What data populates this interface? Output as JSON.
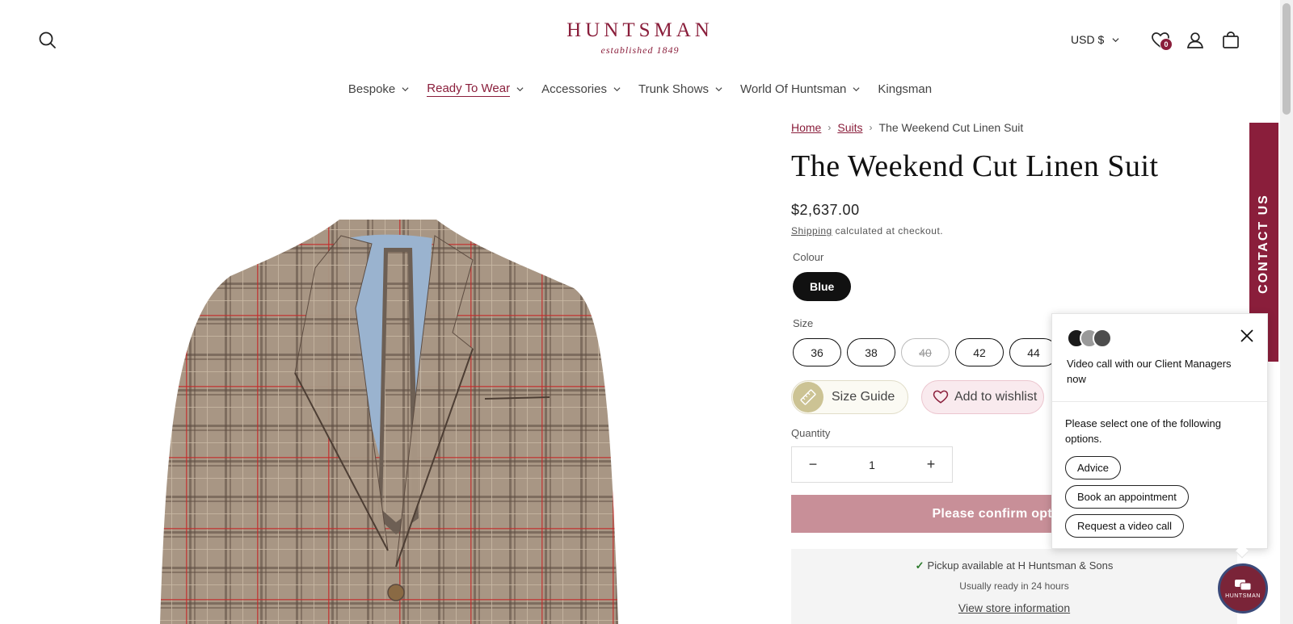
{
  "header": {
    "logo_word": "HUNTSMAN",
    "logo_sub": "established 1849",
    "currency": "USD $",
    "wishlist_count": "0"
  },
  "nav": {
    "items": [
      {
        "label": "Bespoke",
        "has_dropdown": true,
        "active": false
      },
      {
        "label": "Ready To Wear",
        "has_dropdown": true,
        "active": true
      },
      {
        "label": "Accessories",
        "has_dropdown": true,
        "active": false
      },
      {
        "label": "Trunk Shows",
        "has_dropdown": true,
        "active": false
      },
      {
        "label": "World Of Huntsman",
        "has_dropdown": true,
        "active": false
      },
      {
        "label": "Kingsman",
        "has_dropdown": false,
        "active": false
      }
    ]
  },
  "breadcrumb": {
    "home": "Home",
    "suits": "Suits",
    "current": "The Weekend Cut Linen Suit"
  },
  "product": {
    "title": "The Weekend Cut Linen Suit",
    "price": "$2,637.00",
    "shipping_link": "Shipping",
    "shipping_text": " calculated at checkout.",
    "colour_label": "Colour",
    "colour_selected": "Blue",
    "size_label": "Size",
    "sizes": [
      {
        "label": "36",
        "available": true
      },
      {
        "label": "38",
        "available": true
      },
      {
        "label": "40",
        "available": false
      },
      {
        "label": "42",
        "available": true
      },
      {
        "label": "44",
        "available": true
      }
    ],
    "size_guide_label": "Size Guide",
    "wishlist_label": "Add to wishlist",
    "quantity_label": "Quantity",
    "quantity_value": "1",
    "quantity_minus": "−",
    "quantity_plus": "+",
    "confirm_label": "Please confirm options to"
  },
  "pickup": {
    "check": "✓",
    "line1_prefix": "Pickup available at ",
    "line1_store": "H Huntsman & Sons",
    "line2": "Usually ready in 24 hours",
    "line3": "View store information"
  },
  "contact_tab": "CONTACT US",
  "chat": {
    "heading": "Video call with our Client Managers now",
    "prompt": "Please select one of the following options.",
    "options": [
      "Advice",
      "Book an appointment",
      "Request a video call"
    ],
    "launcher_brand": "HUNTSMAN"
  },
  "colors": {
    "brand": "#8a1e3b",
    "confirm_button": "#c88f98",
    "wishlist_bg": "#f9eaee",
    "size_guide_bg": "#fbfaf3"
  }
}
